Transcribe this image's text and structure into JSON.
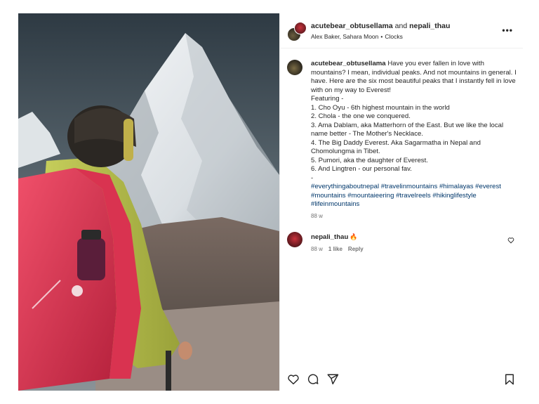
{
  "header": {
    "user1": "acutebear_obtusellama",
    "and": " and ",
    "user2": "nepali_thau",
    "audio_artist": "Alex Baker, Sahara Moon",
    "dot": "•",
    "audio_track": "Clocks",
    "more": "•••"
  },
  "caption": {
    "username": "acutebear_obtusellama",
    "text": "Have you ever fallen in love with mountains? I mean, individual peaks. And not mountains in general. I have. Here are the six most beautiful peaks that I instantly fell in love with on my way to Everest!",
    "featuring": "Featuring -",
    "items": [
      "1. Cho Oyu - 6th highest mountain in the world",
      "2. Chola - the one we conquered.",
      "3. Ama Dablam, aka Matterhorn of the East. But we like the local name better - The Mother's Necklace.",
      "4. The Big Daddy Everest. Aka Sagarmatha in Nepal and Chomolungma in Tibet.",
      "5. Pumori, aka the daughter of Everest.",
      "6. And Lingtren - our personal fav."
    ],
    "dash": "-",
    "hashtags": [
      "#everythingaboutnepal",
      "#travelinmountains",
      "#himalayas",
      "#everest",
      "#mountains",
      "#mountaieering",
      "#travelreels",
      "#hikinglifestyle",
      "#lifeinmountains"
    ],
    "time": "88 w"
  },
  "comment": {
    "username": "nepali_thau",
    "emoji": "🔥",
    "time": "88 w",
    "likes": "1 like",
    "reply": "Reply"
  },
  "icons": {
    "more": "more-options-icon",
    "like": "heart-icon",
    "comment": "comment-icon",
    "share": "share-icon",
    "save": "bookmark-icon"
  }
}
